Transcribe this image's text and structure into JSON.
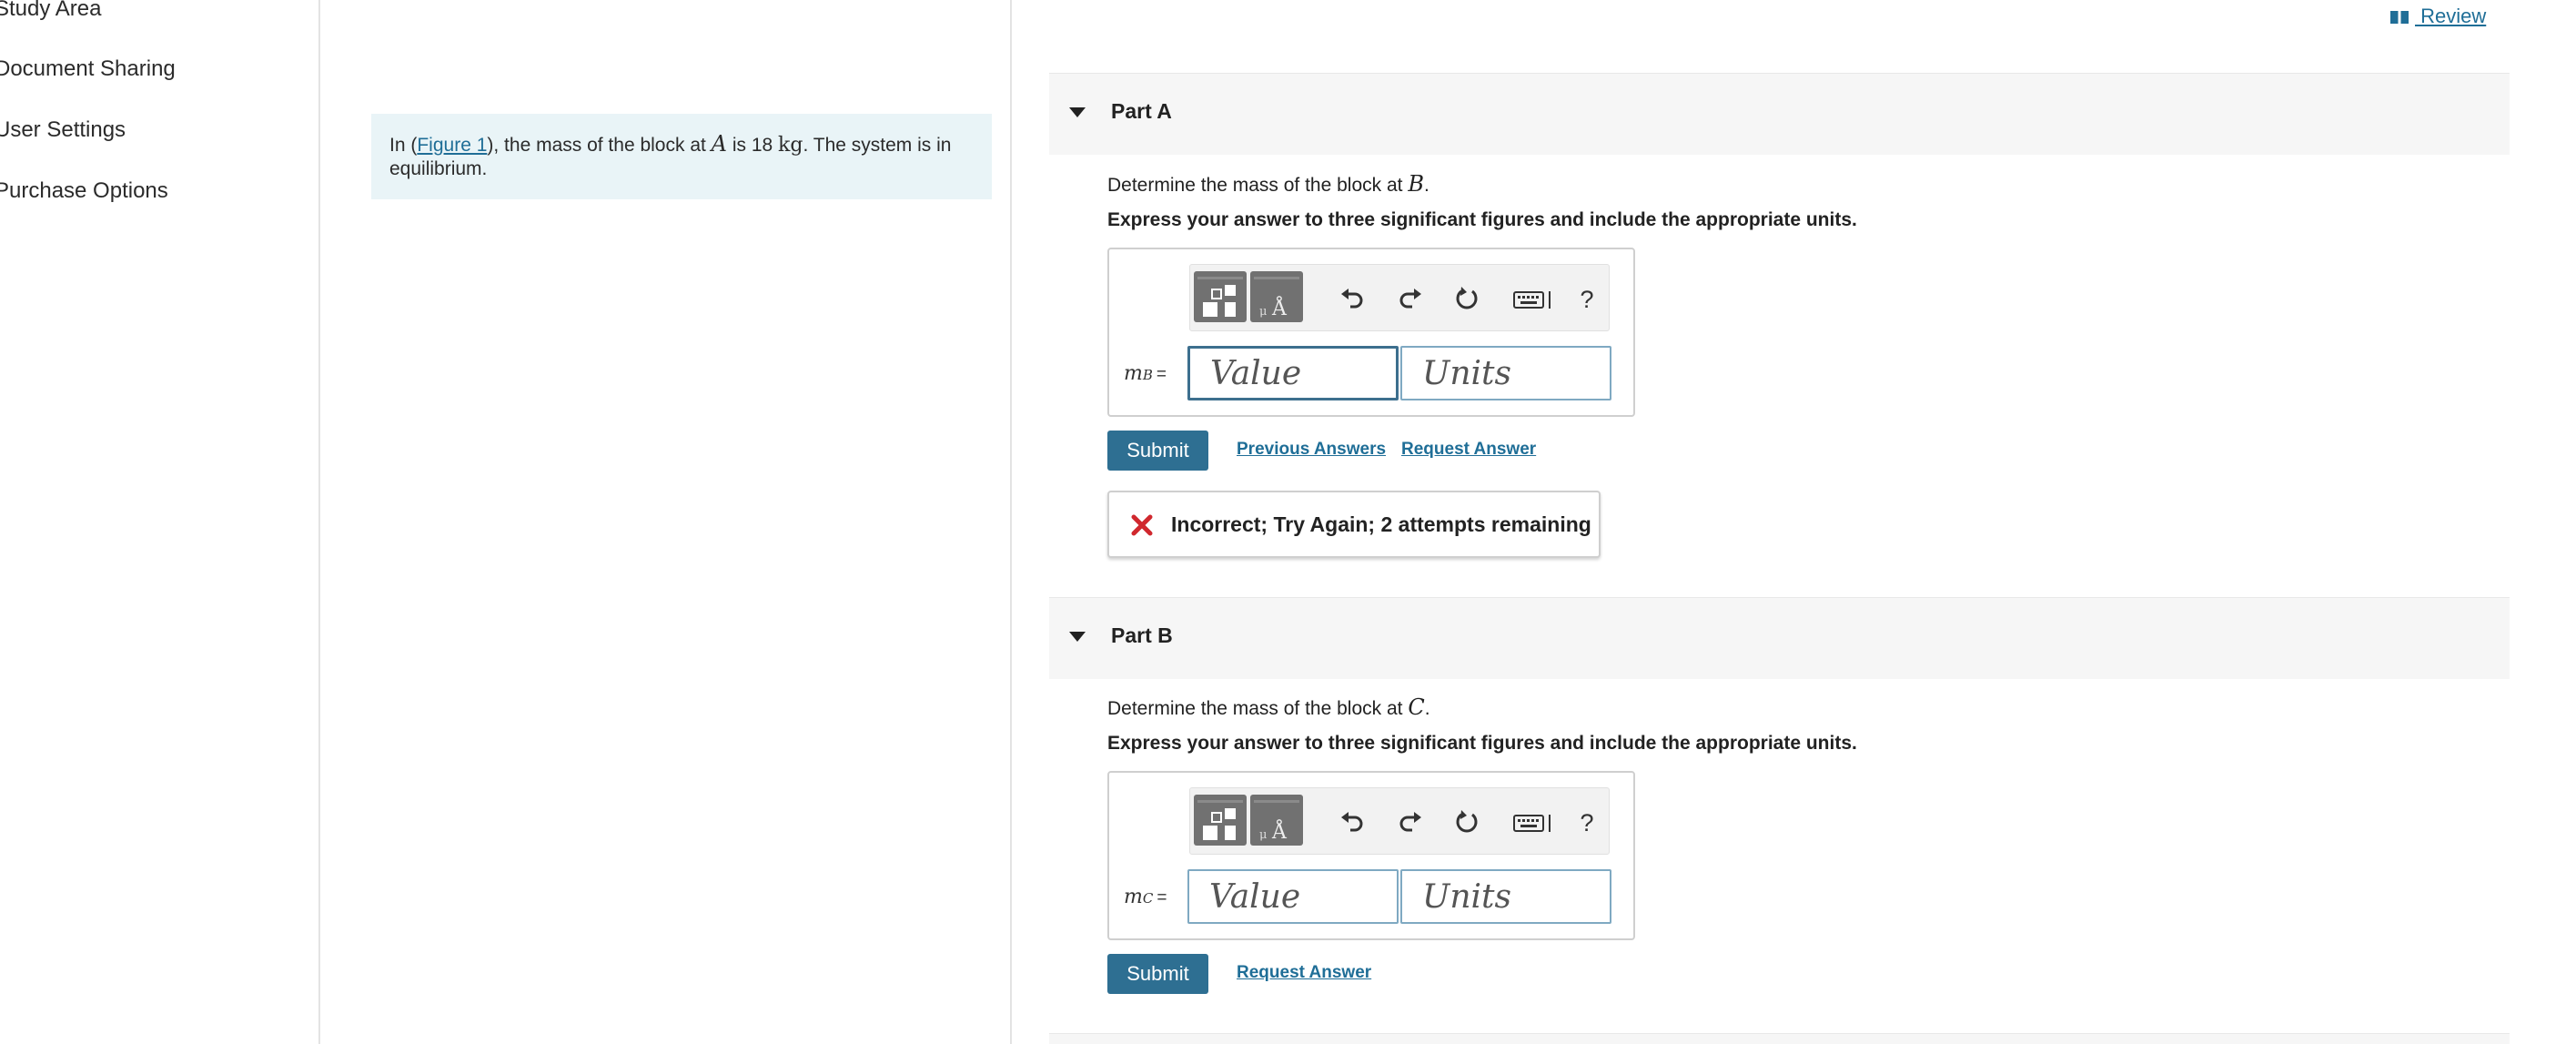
{
  "nav": {
    "items": [
      {
        "label": "Study Area"
      },
      {
        "label": "Document Sharing"
      },
      {
        "label": "User Settings"
      },
      {
        "label": "Purchase Options"
      }
    ]
  },
  "problem": {
    "intro_prefix": "In (",
    "figure_link": "Figure 1",
    "intro_mid": "), the mass of the block at ",
    "var_a": "A",
    "intro_is": " is 18 ",
    "unit_kg": "kg",
    "intro_suffix": ". The system is in equilibrium."
  },
  "review": {
    "label": " Review"
  },
  "parts": [
    {
      "title": "Part A",
      "question_prefix": "Determine the mass of the block at ",
      "question_var": "B",
      "question_suffix": ".",
      "instruction": "Express your answer to three significant figures and include the appropriate units.",
      "var_symbol": "m",
      "var_sub": "B",
      "var_eq": "=",
      "value_placeholder": "Value",
      "units_placeholder": "Units",
      "submit_label": "Submit",
      "previous_answers_label": "Previous Answers",
      "request_answer_label": "Request Answer",
      "feedback": "Incorrect; Try Again; 2 attempts remaining"
    },
    {
      "title": "Part B",
      "question_prefix": "Determine the mass of the block at ",
      "question_var": "C",
      "question_suffix": ".",
      "instruction": "Express your answer to three significant figures and include the appropriate units.",
      "var_symbol": "m",
      "var_sub": "C",
      "var_eq": "=",
      "value_placeholder": "Value",
      "units_placeholder": "Units",
      "submit_label": "Submit",
      "request_answer_label": "Request Answer"
    }
  ],
  "toolbar": {
    "help_label": "?"
  },
  "colors": {
    "link": "#1f6e97",
    "submit_bg": "#2e6f92",
    "intro_bg": "#e9f4f7",
    "error_icon": "#d0282e",
    "part_header_bg": "#f6f6f6"
  }
}
